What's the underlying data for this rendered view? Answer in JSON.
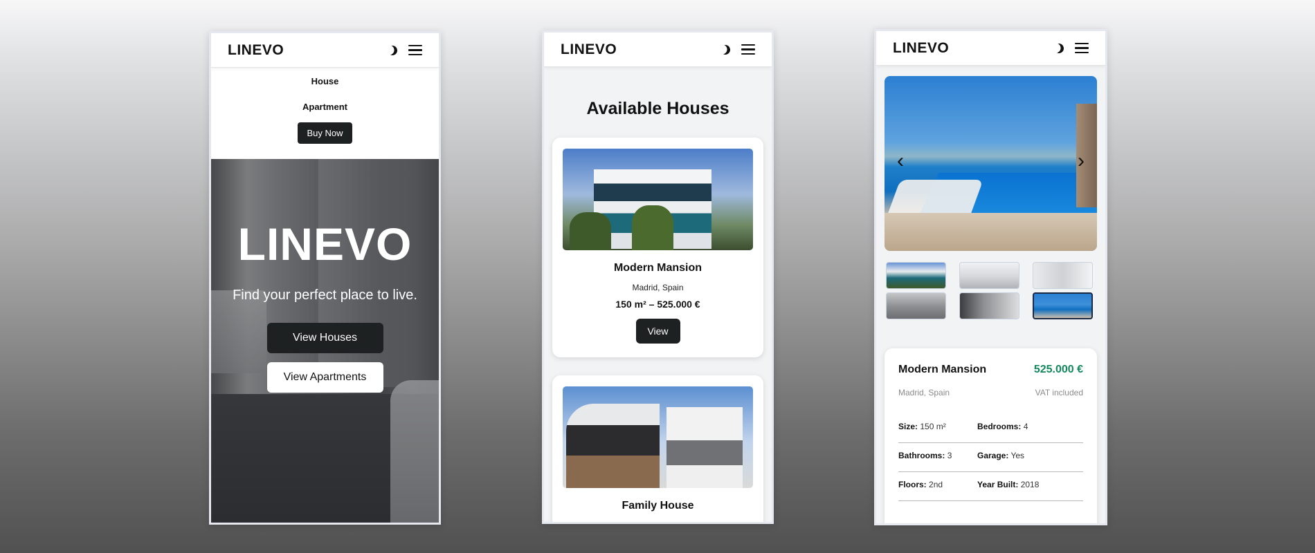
{
  "brand": "LINEVO",
  "icons": {
    "theme_toggle": "moon-icon",
    "menu": "hamburger-icon",
    "prev": "chevron-left-icon",
    "next": "chevron-right-icon"
  },
  "screen1": {
    "menu": {
      "items": [
        "House",
        "Apartment"
      ],
      "cta": "Buy Now"
    },
    "hero": {
      "title": "LINEVO",
      "subtitle": "Find your perfect place to live.",
      "primary_button": "View Houses",
      "secondary_button": "View Apartments"
    }
  },
  "screen2": {
    "title": "Available Houses",
    "cards": [
      {
        "name": "Modern Mansion",
        "location": "Madrid, Spain",
        "meta": "150 m² – 525.000 €",
        "button": "View"
      },
      {
        "name": "Family House"
      }
    ]
  },
  "screen3": {
    "gallery": {
      "thumbnail_count": 6,
      "active_thumbnail": 6
    },
    "details": {
      "name": "Modern Mansion",
      "price": "525.000 €",
      "location": "Madrid, Spain",
      "vat": "VAT included",
      "specs": [
        {
          "label": "Size:",
          "value": "150 m²"
        },
        {
          "label": "Bedrooms:",
          "value": "4"
        },
        {
          "label": "Bathrooms:",
          "value": "3"
        },
        {
          "label": "Garage:",
          "value": "Yes"
        },
        {
          "label": "Floors:",
          "value": "2nd"
        },
        {
          "label": "Year Built:",
          "value": "2018"
        }
      ]
    }
  },
  "colors": {
    "dark_button": "#1e2121",
    "price_green": "#12885c"
  }
}
